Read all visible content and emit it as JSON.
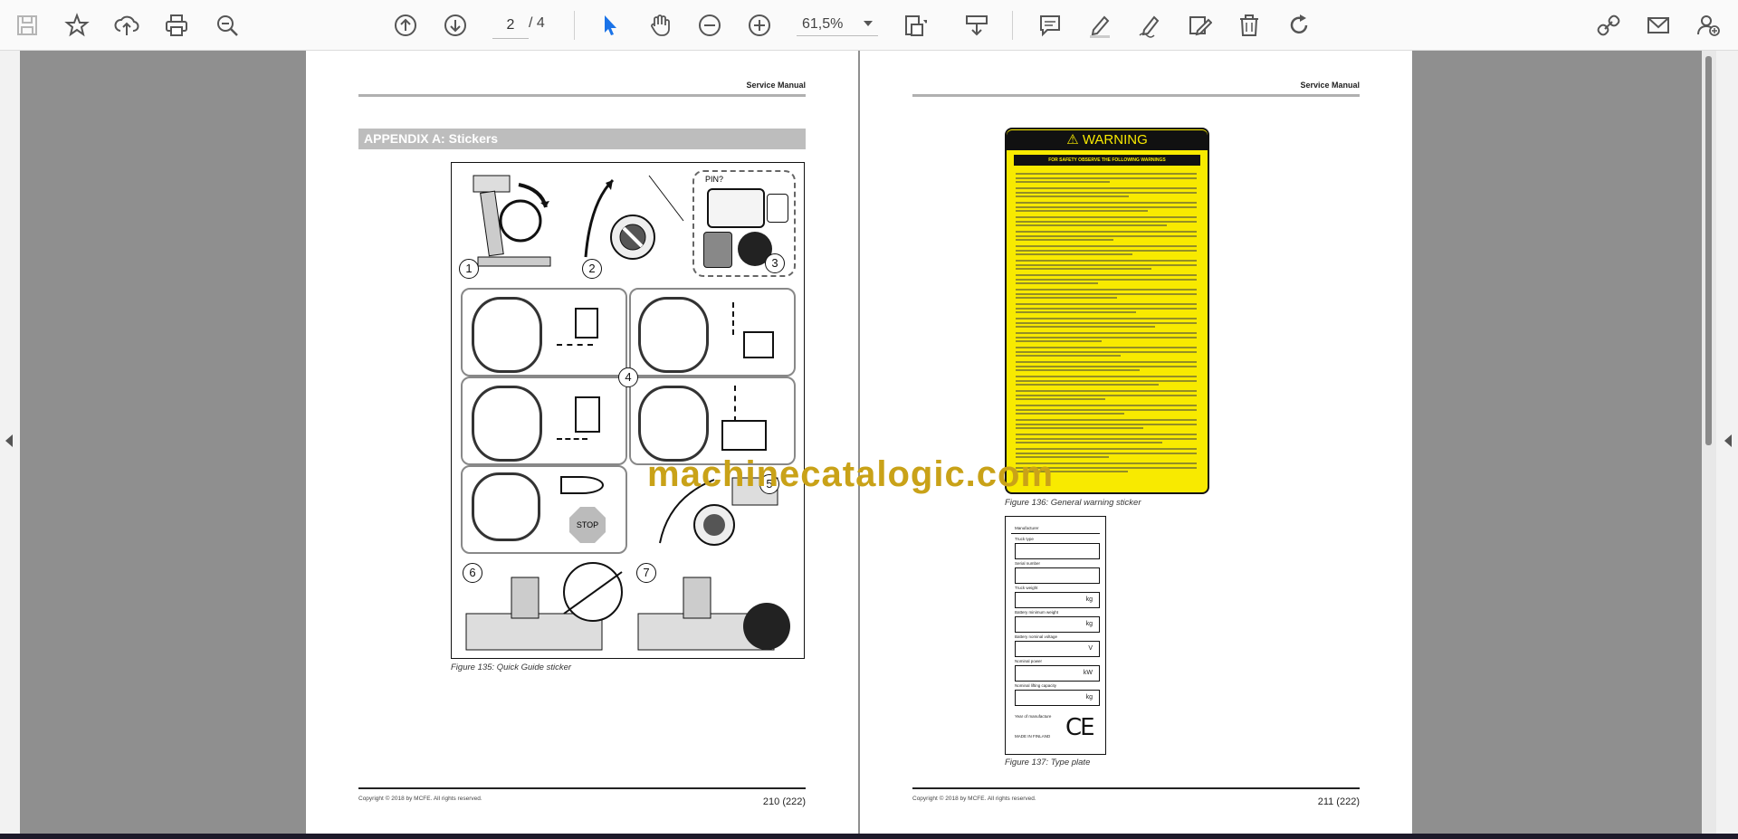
{
  "toolbar": {
    "current_page": "2",
    "total_pages": "/ 4",
    "zoom": "61,5%"
  },
  "page_left": {
    "header": "Service Manual",
    "section_title": "APPENDIX A: Stickers",
    "figure_caption": "Figure 135: Quick Guide sticker",
    "copyright": "Copyright © 2018 by MCFE. All rights reserved.",
    "page_number": "210 (222)",
    "sticker_labels": [
      "PIN?",
      "STOP",
      "1",
      "2",
      "3",
      "4",
      "5",
      "6",
      "7"
    ]
  },
  "page_right": {
    "header": "Service Manual",
    "warning_title": "WARNING",
    "warning_subtitle": "FOR SAFETY OBSERVE THE FOLLOWING WARNINGS",
    "warning_caption": "Figure 136: General warning sticker",
    "type_plate_caption": "Figure 137: Type plate",
    "type_plate": {
      "manufacturer": "Manufacturer",
      "fields": [
        {
          "label": "Truck type",
          "unit": ""
        },
        {
          "label": "Serial number",
          "unit": ""
        },
        {
          "label": "Truck weight",
          "unit": "kg"
        },
        {
          "label": "Battery minimum weight",
          "unit": "kg"
        },
        {
          "label": "Battery nominal voltage",
          "unit": "V"
        },
        {
          "label": "Nominal power",
          "unit": "kW"
        },
        {
          "label": "Nominal lifting capacity",
          "unit": "kg"
        }
      ],
      "year": "Year of manufacture",
      "made_in": "MADE IN FINLAND",
      "ce": "CE"
    },
    "copyright": "Copyright © 2018 by MCFE. All rights reserved.",
    "page_number": "211 (222)"
  },
  "watermark": "machinecatalogic.com"
}
